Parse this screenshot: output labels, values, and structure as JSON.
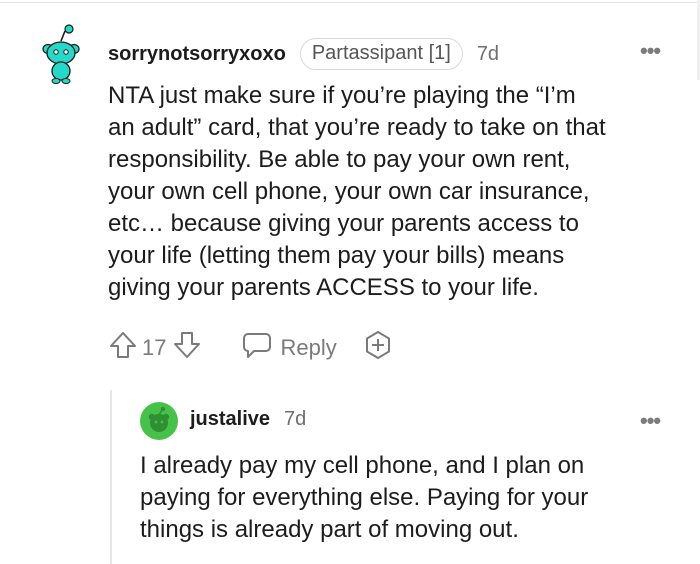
{
  "comments": [
    {
      "username": "sorrynotsorryxoxo",
      "flair": "Partassipant [1]",
      "age": "7d",
      "more": "•••",
      "body": "NTA just make sure if you’re playing the “I’m\nan adult” card, that you’re ready to take on that\nresponsibility. Be able to pay your own rent,\nyour own cell phone, your own car insurance,\netc… because giving your parents access to\nyour life (letting them pay your bills) means\ngiving your parents ACCESS to your life.",
      "votes": "17",
      "reply_label": "Reply",
      "avatar_icon": "snoo-avatar-icon",
      "avatar_color": "#24d9c8"
    },
    {
      "username": "justalive",
      "age": "7d",
      "more": "•••",
      "body": "I already pay my cell phone, and I plan on\npaying for everything else. Paying for your\nthings is already part of moving out.",
      "avatar_icon": "snoo-avatar-icon",
      "avatar_color": "#46c24a"
    }
  ],
  "icons": {
    "upvote": "upvote-arrow-icon",
    "downvote": "downvote-arrow-icon",
    "reply": "speech-bubble-icon",
    "award": "award-plus-icon"
  },
  "colors": {
    "text": "#1c1c1c",
    "meta": "#7a7a7a"
  }
}
